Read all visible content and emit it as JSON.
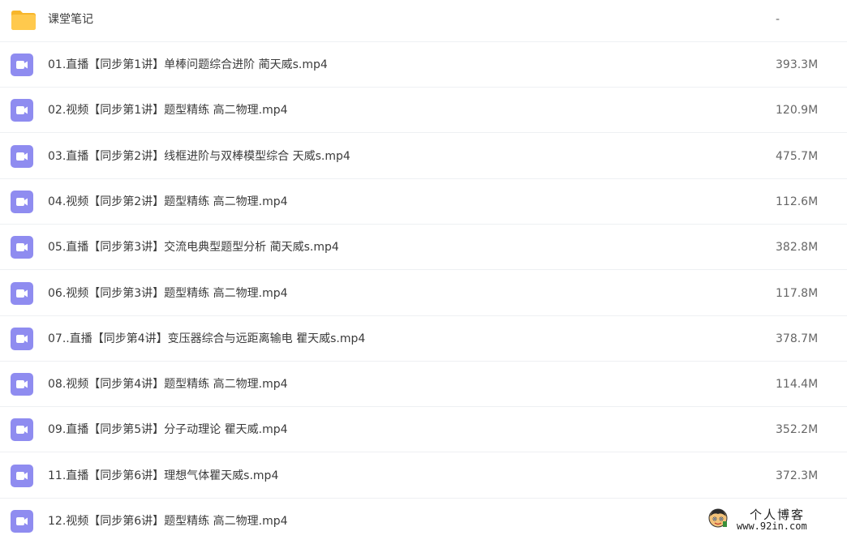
{
  "files": [
    {
      "icon": "folder-icon",
      "name": "课堂笔记",
      "size": "-"
    },
    {
      "icon": "video-icon",
      "name": "01.直播【同步第1讲】单棒问题综合进阶 蔺天威s.mp4",
      "size": "393.3M"
    },
    {
      "icon": "video-icon",
      "name": "02.视频【同步第1讲】题型精练 高二物理.mp4",
      "size": "120.9M"
    },
    {
      "icon": "video-icon",
      "name": "03.直播【同步第2讲】线框进阶与双棒模型综合 天威s.mp4",
      "size": "475.7M"
    },
    {
      "icon": "video-icon",
      "name": "04.视频【同步第2讲】题型精练 高二物理.mp4",
      "size": "112.6M"
    },
    {
      "icon": "video-icon",
      "name": "05.直播【同步第3讲】交流电典型题型分析 蔺天威s.mp4",
      "size": "382.8M"
    },
    {
      "icon": "video-icon",
      "name": "06.视频【同步第3讲】题型精练 高二物理.mp4",
      "size": "117.8M"
    },
    {
      "icon": "video-icon",
      "name": "07..直播【同步第4讲】变压器综合与远距离输电 瞿天威s.mp4",
      "size": "378.7M"
    },
    {
      "icon": "video-icon",
      "name": "08.视频【同步第4讲】题型精练 高二物理.mp4",
      "size": "114.4M"
    },
    {
      "icon": "video-icon",
      "name": "09.直播【同步第5讲】分子动理论 瞿天威.mp4",
      "size": "352.2M"
    },
    {
      "icon": "video-icon",
      "name": "11.直播【同步第6讲】理想气体瞿天威s.mp4",
      "size": "372.3M"
    },
    {
      "icon": "video-icon",
      "name": "12.视频【同步第6讲】题型精练 高二物理.mp4",
      "size": ""
    }
  ],
  "watermark": {
    "title": "个人博客",
    "url": "www.92in.com"
  },
  "colors": {
    "folder": "#ffc53d",
    "folder_tab": "#f7b62b",
    "video": "#8f8cf0",
    "divider": "#eef0f3"
  }
}
